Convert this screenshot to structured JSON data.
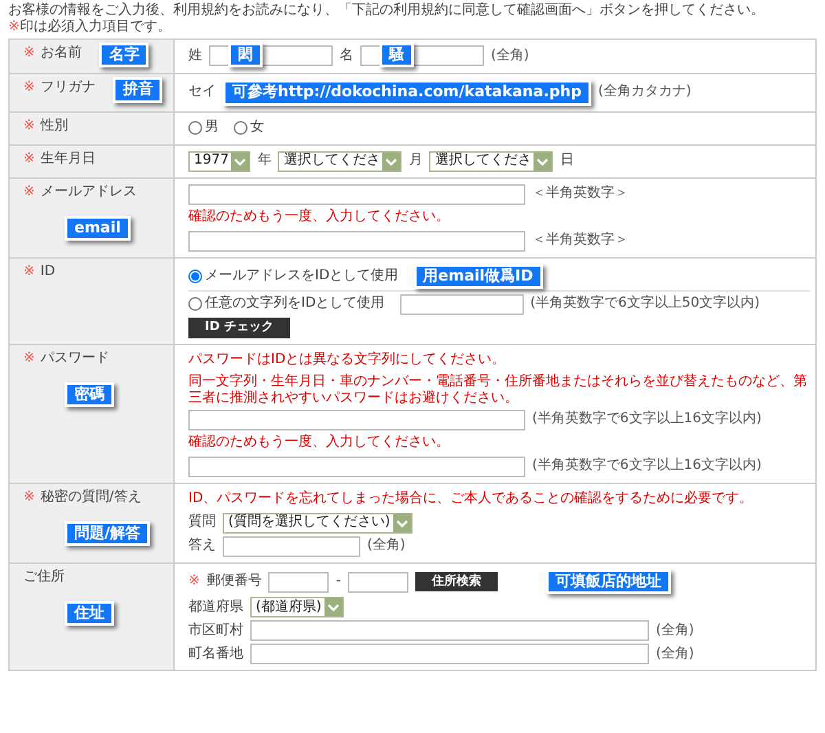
{
  "intro": "お客様の情報をご入力後、利用規約をお読みになり、「下記の利用規約に同意して確認画面へ」ボタンを押してください。",
  "required_note": {
    "mark": "※",
    "text": "印は必須入力項目です。"
  },
  "rows": [
    {
      "label": "お名前",
      "required": true,
      "annotation": "名字",
      "lines": [
        {
          "parts": [
            {
              "kind": "text",
              "text": "姓"
            },
            {
              "kind": "input-medium",
              "annotation": "閎"
            },
            {
              "kind": "text",
              "text": "名"
            },
            {
              "kind": "input-medium",
              "annotation": "騷"
            },
            {
              "kind": "note",
              "text": "(全角)"
            }
          ]
        }
      ]
    },
    {
      "label": "フリガナ",
      "required": true,
      "annotation": "拚音",
      "lines": [
        {
          "parts": [
            {
              "kind": "text",
              "text": "セイ"
            },
            {
              "kind": "annotation",
              "text": "可參考http://dokochina.com/katakana.php"
            },
            {
              "kind": "note",
              "text": "(全角カタカナ)"
            }
          ]
        }
      ]
    },
    {
      "label": "性別",
      "required": true,
      "lines": [
        {
          "parts": [
            {
              "kind": "radio",
              "text": "男",
              "selected": false
            },
            {
              "kind": "radio",
              "text": "女",
              "selected": false
            }
          ]
        }
      ]
    },
    {
      "label": "生年月日",
      "required": true,
      "lines": [
        {
          "parts": [
            {
              "kind": "select",
              "text": "1977"
            },
            {
              "kind": "text",
              "text": "年"
            },
            {
              "kind": "select",
              "text": "選択してくださ"
            },
            {
              "kind": "text",
              "text": "月"
            },
            {
              "kind": "select",
              "text": "選択してくださ"
            },
            {
              "kind": "text",
              "text": "日"
            }
          ]
        }
      ]
    },
    {
      "label": "メールアドレス",
      "required": true,
      "annotation": "email",
      "lines": [
        {
          "parts": [
            {
              "kind": "input"
            },
            {
              "kind": "note",
              "text": "＜半角英数字＞"
            }
          ]
        },
        {
          "parts": [
            {
              "kind": "warning",
              "text": "確認のためもう一度、入力してください。"
            }
          ]
        },
        {
          "parts": [
            {
              "kind": "input"
            },
            {
              "kind": "note",
              "text": "＜半角英数字＞"
            }
          ]
        }
      ]
    },
    {
      "label": "ID",
      "required": true,
      "lines": [
        {
          "rule_below": true,
          "parts": [
            {
              "kind": "radio",
              "text": "メールアドレスをIDとして使用",
              "selected": true
            },
            {
              "kind": "annotation",
              "text": "用email做爲ID"
            }
          ]
        },
        {
          "parts": [
            {
              "kind": "radio",
              "text": "任意の文字列をIDとして使用",
              "selected": false
            },
            {
              "kind": "input-medium"
            },
            {
              "kind": "note",
              "text": "(半角英数字で6文字以上50文字以内)"
            }
          ]
        },
        {
          "parts": [
            {
              "kind": "button",
              "text": "ID チェック"
            }
          ]
        }
      ]
    },
    {
      "label": "パスワード",
      "required": true,
      "annotation": "密碼",
      "lines": [
        {
          "parts": [
            {
              "kind": "warning",
              "text": "パスワードはIDとは異なる文字列にしてください。"
            }
          ]
        },
        {
          "parts": [
            {
              "kind": "warning",
              "text": "同一文字列・生年月日・車のナンバー・電話番号・住所番地またはそれらを並び替えたものなど、第三者に推測されやすいパスワードはお避けください。"
            }
          ]
        },
        {
          "parts": [
            {
              "kind": "input"
            },
            {
              "kind": "note",
              "text": "(半角英数字で6文字以上16文字以内)"
            }
          ]
        },
        {
          "parts": [
            {
              "kind": "warning",
              "text": "確認のためもう一度、入力してください。"
            }
          ]
        },
        {
          "parts": [
            {
              "kind": "input"
            },
            {
              "kind": "note",
              "text": "(半角英数字で6文字以上16文字以内)"
            }
          ]
        }
      ]
    },
    {
      "label": "秘密の質問/答え",
      "required": true,
      "annotation": "問題/解答",
      "lines": [
        {
          "parts": [
            {
              "kind": "warning",
              "text": "ID、パスワードを忘れてしまった場合に、ご本人であることの確認をするために必要です。"
            }
          ]
        },
        {
          "parts": [
            {
              "kind": "text",
              "text": "質問"
            },
            {
              "kind": "select",
              "text": "(質問を選択してください)"
            }
          ]
        },
        {
          "parts": [
            {
              "kind": "text",
              "text": "答え"
            },
            {
              "kind": "input-answer"
            },
            {
              "kind": "note",
              "text": "(全角)"
            }
          ]
        }
      ]
    },
    {
      "label": "ご住所",
      "required": false,
      "annotation": "住址",
      "lines": [
        {
          "parts": [
            {
              "kind": "required",
              "text": "※"
            },
            {
              "kind": "text",
              "text": "郵便番号"
            },
            {
              "kind": "input-short"
            },
            {
              "kind": "text",
              "text": "-"
            },
            {
              "kind": "input-short"
            },
            {
              "kind": "button",
              "text": "住所検索"
            },
            {
              "kind": "annotation",
              "text": "可填飯店的地址"
            }
          ]
        },
        {
          "parts": [
            {
              "kind": "text",
              "text": "都道府県"
            },
            {
              "kind": "select",
              "text": "(都道府県)"
            }
          ]
        },
        {
          "parts": [
            {
              "kind": "text",
              "text": "市区町村"
            },
            {
              "kind": "input-wide"
            },
            {
              "kind": "note",
              "text": "(全角)"
            }
          ]
        },
        {
          "parts": [
            {
              "kind": "text",
              "text": "町名番地"
            },
            {
              "kind": "input-wide"
            },
            {
              "kind": "note",
              "text": "(全角)"
            }
          ]
        }
      ]
    }
  ]
}
